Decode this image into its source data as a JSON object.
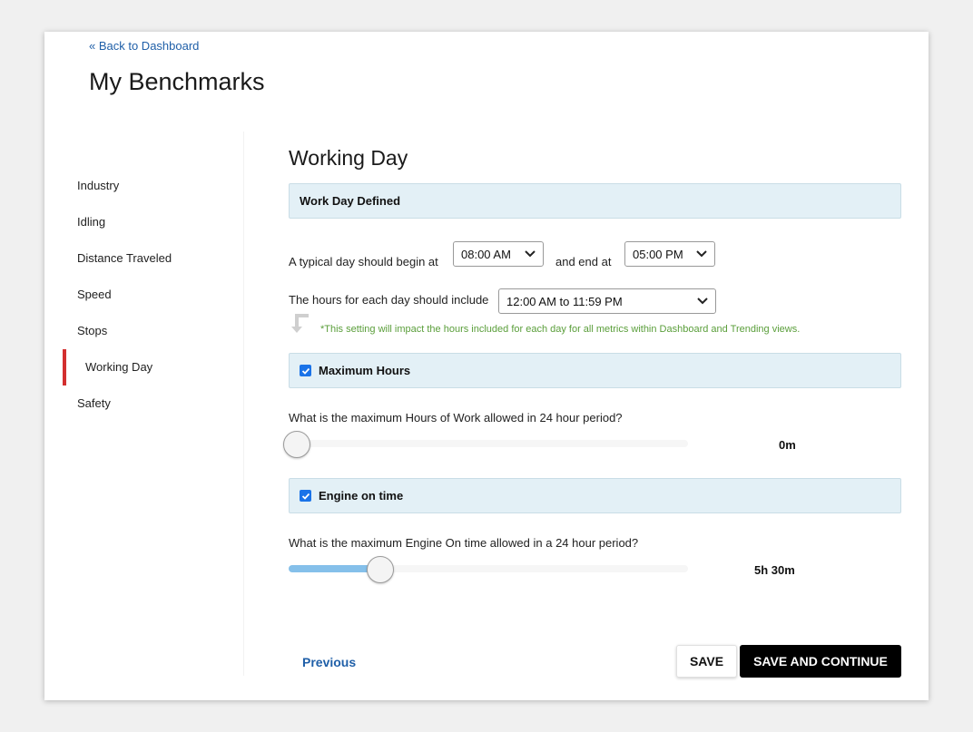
{
  "header": {
    "back_link": "« Back to Dashboard",
    "page_title": "My Benchmarks"
  },
  "sidebar": {
    "items": [
      {
        "label": "Industry",
        "active": false
      },
      {
        "label": "Idling",
        "active": false
      },
      {
        "label": "Distance Traveled",
        "active": false
      },
      {
        "label": "Speed",
        "active": false
      },
      {
        "label": "Stops",
        "active": false
      },
      {
        "label": "Working Day",
        "active": true
      },
      {
        "label": "Safety",
        "active": false
      }
    ]
  },
  "main": {
    "section_title": "Working Day",
    "work_day": {
      "band_title": "Work Day Defined",
      "begin_label": "A typical day should begin at",
      "begin_value": "08:00 AM",
      "end_label": "and end at",
      "end_value": "05:00 PM",
      "hours_label": "The hours for each day should include",
      "hours_value": "12:00 AM to 11:59 PM",
      "note": "*This setting will impact the hours included for each day for all metrics within Dashboard and Trending views."
    },
    "max_hours": {
      "band_title": "Maximum Hours",
      "checked": true,
      "question": "What is the maximum Hours of Work allowed in 24 hour period?",
      "value": "0m",
      "fraction": 0.0
    },
    "engine_on": {
      "band_title": "Engine on time",
      "checked": true,
      "question": "What is the maximum Engine On time allowed in a 24 hour period?",
      "value": "5h 30m",
      "fraction": 0.229
    }
  },
  "footer": {
    "previous_label": "Previous",
    "save_label": "SAVE",
    "save_continue_label": "SAVE AND CONTINUE"
  },
  "colors": {
    "accent_active": "#d32f2f",
    "link": "#1f5fa8",
    "band_bg": "#e3f0f6",
    "note": "#5a9e3a",
    "slider_fill": "#85c0ea",
    "checkbox": "#1a73e8"
  },
  "icons": {
    "caret": "chevron-down-icon",
    "note_arrow": "arrow-turn-down-right-icon",
    "checkbox": "check-icon"
  }
}
